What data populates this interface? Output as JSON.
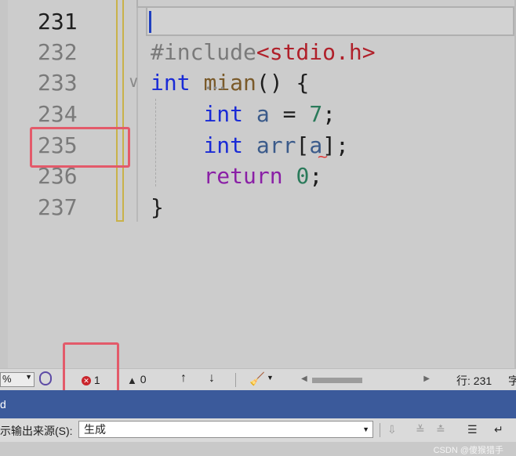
{
  "editor": {
    "line_numbers": [
      "231",
      "232",
      "233",
      "234",
      "235",
      "236",
      "237"
    ],
    "current_line_index": 0,
    "lines": [
      [],
      [
        {
          "t": "#include",
          "c": "pp"
        },
        {
          "t": "<stdio.h>",
          "c": "str"
        }
      ],
      [
        {
          "t": "int",
          "c": "kw"
        },
        {
          "t": " "
        },
        {
          "t": "mian",
          "c": "fn"
        },
        {
          "t": "() {"
        }
      ],
      [
        {
          "t": "    "
        },
        {
          "t": "int",
          "c": "kw"
        },
        {
          "t": " "
        },
        {
          "t": "a",
          "c": "var"
        },
        {
          "t": " = "
        },
        {
          "t": "7",
          "c": "num"
        },
        {
          "t": ";"
        }
      ],
      [
        {
          "t": "    "
        },
        {
          "t": "int",
          "c": "kw"
        },
        {
          "t": " "
        },
        {
          "t": "arr",
          "c": "var"
        },
        {
          "t": "["
        },
        {
          "t": "a",
          "c": "var"
        },
        {
          "t": "];"
        }
      ],
      [
        {
          "t": "    "
        },
        {
          "t": "return",
          "c": "ret"
        },
        {
          "t": " "
        },
        {
          "t": "0",
          "c": "num"
        },
        {
          "t": ";"
        }
      ],
      [
        {
          "t": "}"
        }
      ]
    ]
  },
  "status": {
    "zoom": "%",
    "error_count": "1",
    "warning_count": "0",
    "up_arrow": "↑",
    "down_arrow": "↓",
    "position": "行: 231",
    "encoding": "字"
  },
  "output_panel": {
    "title": "d",
    "source_label": "示输出来源(S):",
    "source_value": "生成"
  },
  "watermark": "CSDN @傻猴猎手",
  "colors": {
    "highlight_box": "#e35a6a",
    "error": "#c9242b",
    "panel_header": "#3b5a9b"
  }
}
